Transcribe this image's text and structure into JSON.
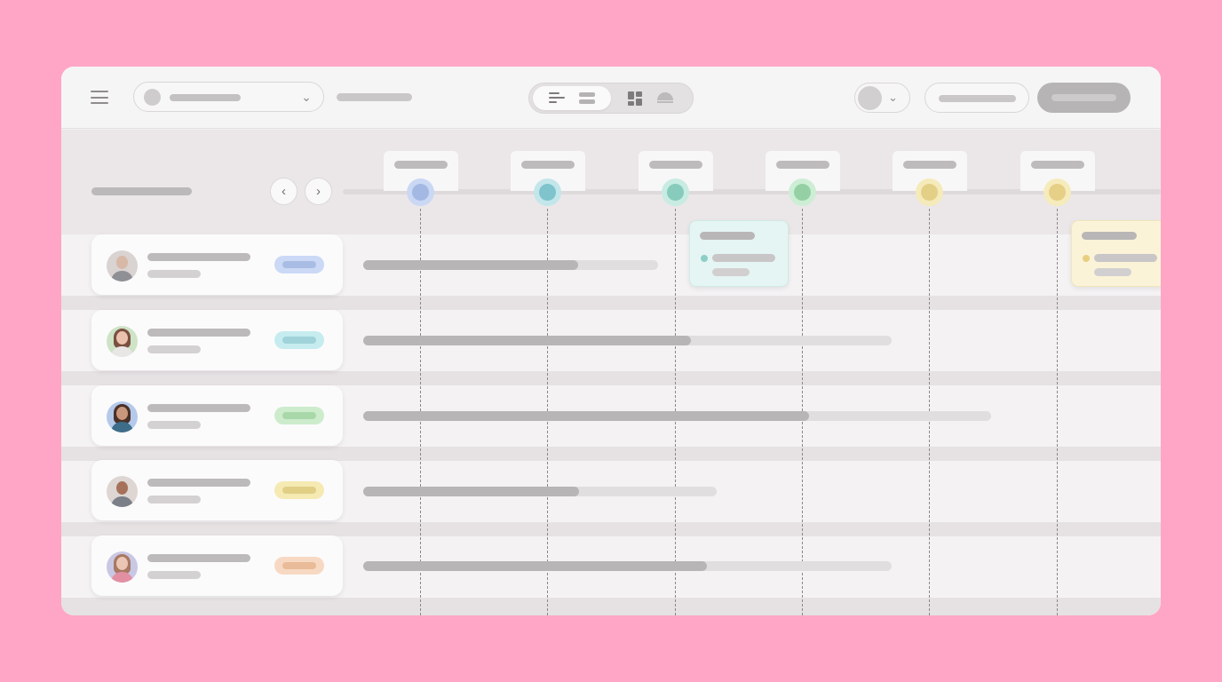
{
  "colors": {
    "page_background": "#ffa6c6",
    "window_background": "#f3f1f2",
    "placeholder_text": "#bdbabb",
    "primary_button": "#b7b4b5"
  },
  "toolbar": {
    "menu_icon": "hamburger-icon",
    "view_modes": [
      "timeline-icon",
      "list-icon",
      "grid-icon",
      "calendar-icon"
    ],
    "active_view": "timeline"
  },
  "milestones": [
    {
      "node_color": "#a3b8e2",
      "ring_color": "#cbd8f4"
    },
    {
      "node_color": "#7fc3cc",
      "ring_color": "#c3e6ea"
    },
    {
      "node_color": "#86cbbb",
      "ring_color": "#c8ebe2"
    },
    {
      "node_color": "#95d0a5",
      "ring_color": "#cdeed5"
    },
    {
      "node_color": "#e3cf86",
      "ring_color": "#f5eab9"
    },
    {
      "node_color": "#e6cf86",
      "ring_color": "#f6ebbb"
    }
  ],
  "rows": [
    {
      "tag_color": "#cbd9f6",
      "tag_inner": "#a9bde4",
      "progress": 0.73,
      "avatar": "neutral"
    },
    {
      "tag_color": "#c6ecef",
      "tag_inner": "#9fd3d9",
      "progress": 0.62,
      "avatar": "woman-long-hair"
    },
    {
      "tag_color": "#cdeccc",
      "tag_inner": "#a8d8a9",
      "progress": 0.71,
      "avatar": "woman-dark-hair"
    },
    {
      "tag_color": "#f6eab3",
      "tag_inner": "#e0cf85",
      "progress": 0.61,
      "avatar": "man"
    },
    {
      "tag_color": "#f7d9c3",
      "tag_inner": "#e9bb98",
      "progress": 0.65,
      "avatar": "woman-pink"
    }
  ],
  "popovers": [
    {
      "background": "#e5f5f3",
      "dot_color": "#8ccfc6"
    },
    {
      "background": "#fbf3d8",
      "dot_color": "#e8cf80"
    }
  ]
}
